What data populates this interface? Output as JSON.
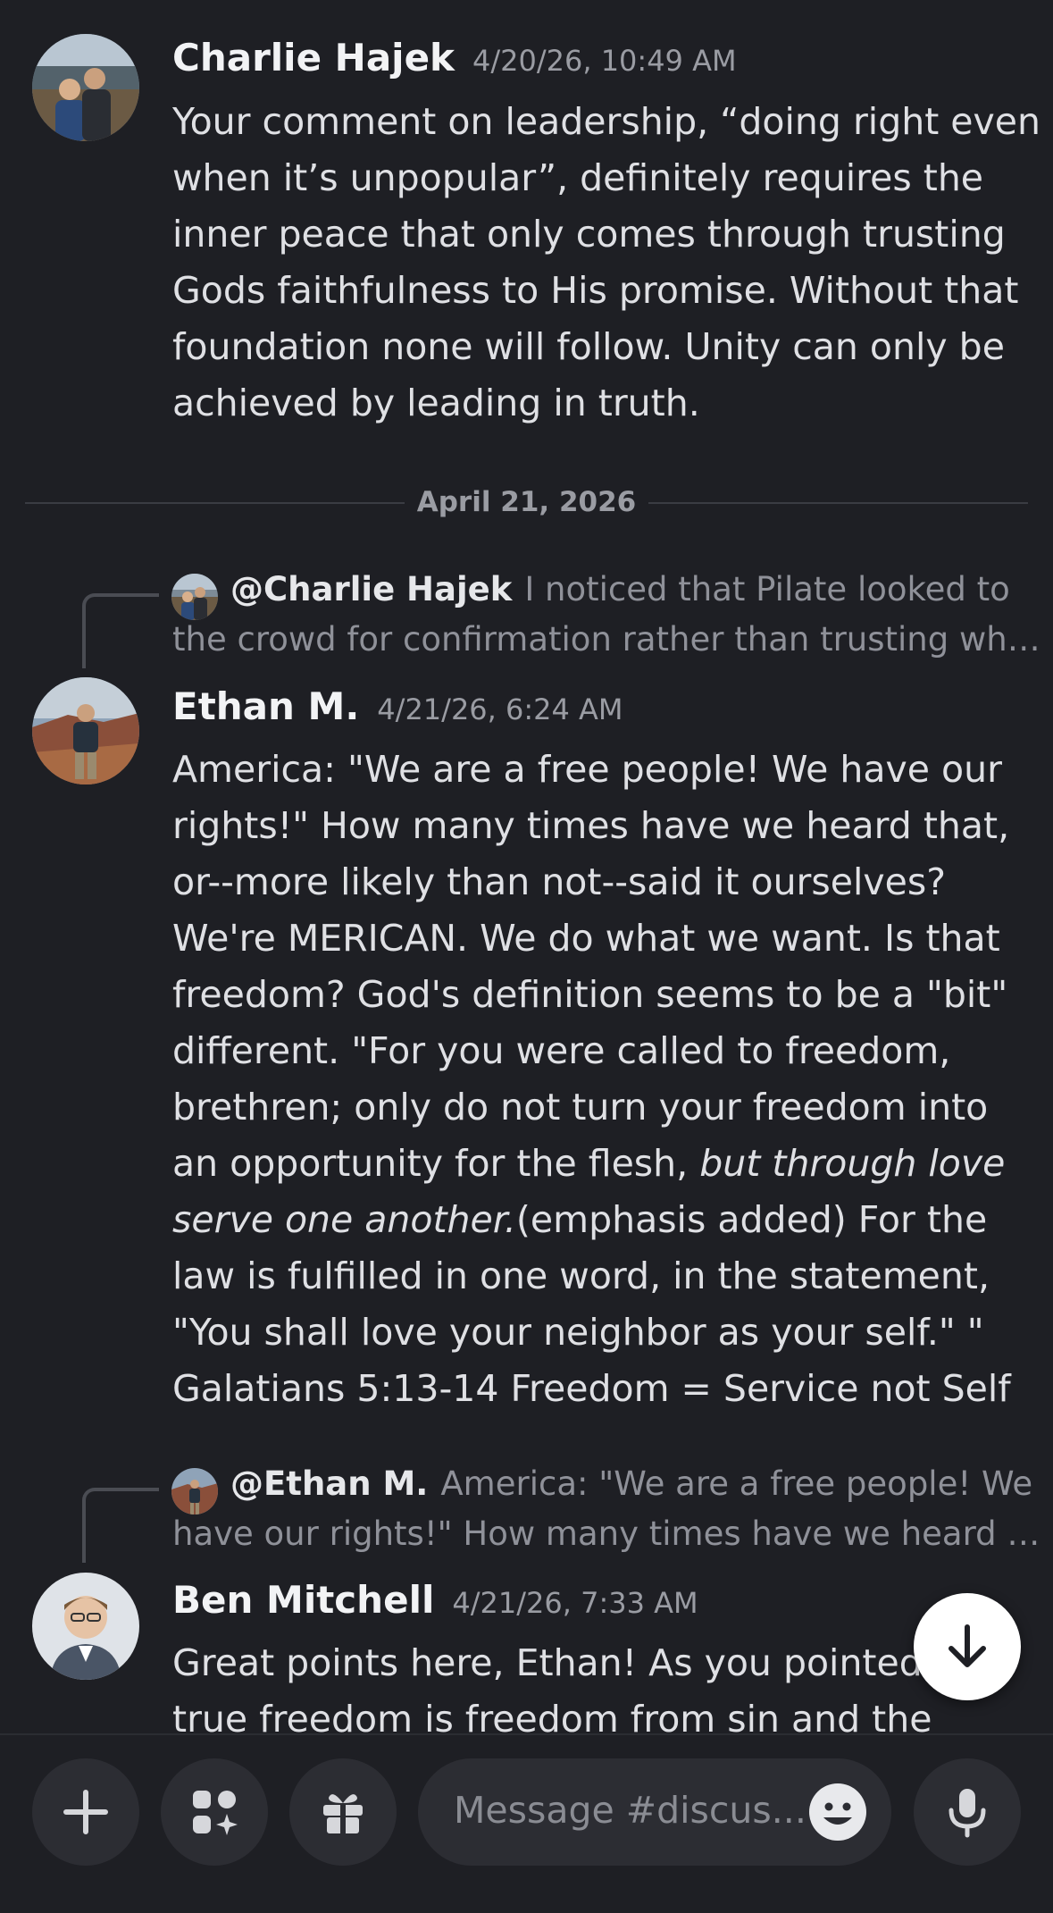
{
  "messages": [
    {
      "author": "Charlie Hajek",
      "timestamp": "4/20/26, 10:49 AM",
      "lines": [
        "Your comment on leadership, “doing right even",
        "when it’s unpopular”, definitely requires the",
        "inner peace that only comes through trusting",
        "Gods faithfulness to His promise. Without that",
        "foundation none will follow. Unity can only be",
        "achieved by leading in truth."
      ]
    },
    {
      "reply": {
        "mention": "@Charlie Hajek",
        "snippet_line1": "I noticed that Pilate looked to",
        "snippet_line2": "the crowd for confirmation rather than trusting wh…"
      },
      "author": "Ethan M.",
      "timestamp": "4/21/26, 6:24 AM",
      "lines": [
        "America: \"We are a free people! We have our",
        "rights!\" How many times have we heard that,",
        "or--more  likely than not--said it ourselves?",
        "We're MERICAN. We do what we want. Is that",
        "freedom? God's definition seems to be a \"bit\"",
        "different. \"For you were called to freedom,",
        "brethren; only do not turn your freedom into"
      ],
      "line_8_plain": "an opportunity for the flesh, ",
      "line_8_italic": "but through love",
      "line_9_italic": "serve one another.",
      "line_9_plain": "(emphasis added) For the",
      "lines_end": [
        "law is fulfilled in one word, in the statement,",
        "\"You shall love your neighbor as your self.\" \"",
        "Galatians 5:13-14 Freedom = Service not Self"
      ]
    },
    {
      "reply": {
        "mention": "@Ethan M.",
        "snippet_line1": "America: \"We are a free people! We",
        "snippet_line2": "have our rights!\" How many times have we heard …"
      },
      "author": "Ben Mitchell",
      "timestamp": "4/21/26, 7:33 AM",
      "lines": [
        "Great points here, Ethan! As you pointed out,",
        "true freedom is freedom from sin and the"
      ]
    }
  ],
  "date_divider": "April 21, 2026",
  "composer": {
    "placeholder": "Message #discus..."
  },
  "icons": {
    "add": "plus-icon",
    "apps": "apps-sparkle-icon",
    "gift": "gift-icon",
    "emoji": "emoji-icon",
    "voice": "microphone-icon",
    "jump": "arrow-down-icon"
  },
  "colors": {
    "background": "#1e1f24",
    "surface": "#2c2d33",
    "text": "#dfe0e4",
    "muted": "#9a9ca3",
    "emoji_yellow": "#e8e9ec"
  }
}
